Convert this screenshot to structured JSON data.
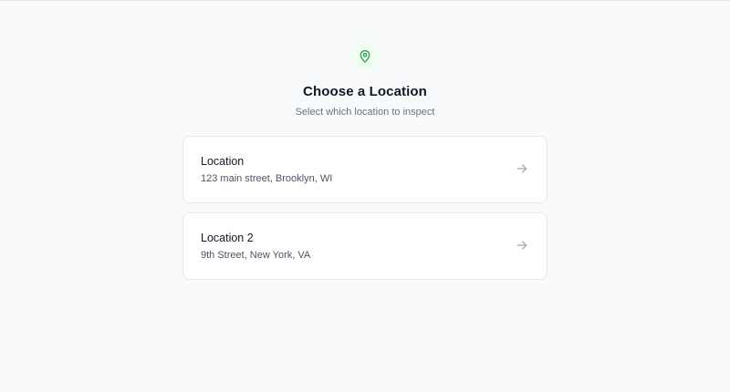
{
  "header": {
    "icon": "map-pin-icon",
    "title": "Choose a Location",
    "subtitle": "Select which location to inspect"
  },
  "locations": [
    {
      "name": "Location",
      "address": "123 main street, Brooklyn, WI"
    },
    {
      "name": "Location 2",
      "address": "9th Street, New York, VA"
    }
  ],
  "colors": {
    "background": "#f9fafb",
    "accent": "#22a34a",
    "accent_bg": "#f0fdf4",
    "card_border": "#e5e7eb",
    "arrow": "#9ca3af"
  }
}
